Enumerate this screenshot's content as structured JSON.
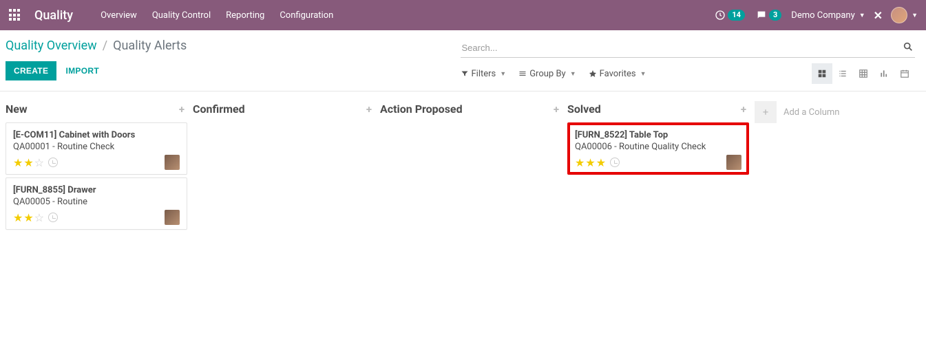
{
  "topbar": {
    "brand": "Quality",
    "nav": [
      "Overview",
      "Quality Control",
      "Reporting",
      "Configuration"
    ],
    "timer_badge": "14",
    "chat_badge": "3",
    "company": "Demo Company"
  },
  "controlbar": {
    "breadcrumb_root": "Quality Overview",
    "breadcrumb_current": "Quality Alerts",
    "create": "CREATE",
    "import": "IMPORT",
    "search_placeholder": "Search...",
    "filters": "Filters",
    "groupby": "Group By",
    "favorites": "Favorites"
  },
  "board": {
    "columns": [
      {
        "title": "New",
        "cards": [
          {
            "title": "[E-COM11] Cabinet with Doors",
            "sub": "QA00001 - Routine Check",
            "stars": 2,
            "highlight": false
          },
          {
            "title": "[FURN_8855] Drawer",
            "sub": "QA00005 - Routine",
            "stars": 2,
            "highlight": false
          }
        ]
      },
      {
        "title": "Confirmed",
        "cards": []
      },
      {
        "title": "Action Proposed",
        "cards": []
      },
      {
        "title": "Solved",
        "cards": [
          {
            "title": "[FURN_8522] Table Top",
            "sub": "QA00006 - Routine Quality Check",
            "stars": 3,
            "highlight": true
          }
        ]
      }
    ],
    "add_column_label": "Add a Column"
  }
}
